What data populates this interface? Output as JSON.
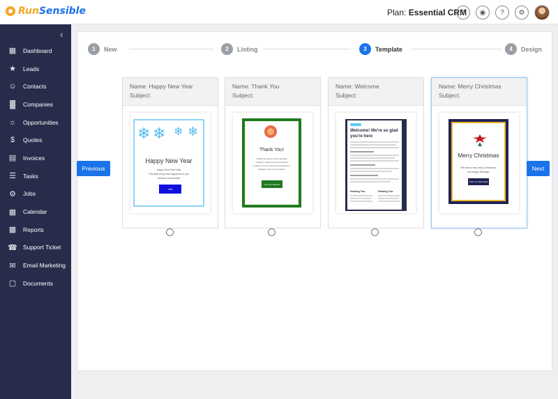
{
  "brand": {
    "part1": "Run",
    "part2": "Sensible"
  },
  "header": {
    "plan_label": "Plan:",
    "plan_name": "Essential CRM",
    "icons": [
      "help-rocket-icon",
      "notification-icon",
      "question-icon",
      "settings-icon"
    ]
  },
  "sidebar": {
    "items": [
      {
        "label": "Dashboard",
        "icon": "dashboard-icon"
      },
      {
        "label": "Leads",
        "icon": "leads-icon"
      },
      {
        "label": "Contacts",
        "icon": "contacts-icon"
      },
      {
        "label": "Companies",
        "icon": "companies-icon"
      },
      {
        "label": "Opportunities",
        "icon": "opportunities-icon"
      },
      {
        "label": "Quotes",
        "icon": "quotes-icon"
      },
      {
        "label": "Invoices",
        "icon": "invoices-icon"
      },
      {
        "label": "Tasks",
        "icon": "tasks-icon"
      },
      {
        "label": "Jobs",
        "icon": "jobs-icon"
      },
      {
        "label": "Calendar",
        "icon": "calendar-icon"
      },
      {
        "label": "Reports",
        "icon": "reports-icon"
      },
      {
        "label": "Support Ticket",
        "icon": "support-icon"
      },
      {
        "label": "Email Marketing",
        "icon": "email-icon"
      },
      {
        "label": "Documents",
        "icon": "documents-icon"
      }
    ]
  },
  "stepper": {
    "steps": [
      {
        "num": "1",
        "label": "New",
        "active": false
      },
      {
        "num": "2",
        "label": "Listing",
        "active": false
      },
      {
        "num": "3",
        "label": "Template",
        "active": true
      },
      {
        "num": "4",
        "label": "Design",
        "active": false
      }
    ]
  },
  "nav_buttons": {
    "previous": "Previous",
    "next": "Next"
  },
  "templates": [
    {
      "name": "Name: Happy New Year",
      "subject": "Subject:",
      "title": "Happy New Year",
      "body": [
        "Happy New Year! May",
        "This year bring new happiness to you",
        "and your loved ones!"
      ],
      "button": "Link",
      "selected": false
    },
    {
      "name": "Name: Thank You",
      "subject": "Subject:",
      "title": "Thank You!",
      "body": [
        "Thanks for being a truly important",
        "customer. Please let our wonderful",
        "contact us if you need any assistance or",
        "problems with your purchase."
      ],
      "button": "Visit Our Website",
      "selected": false
    },
    {
      "name": "Name: Welcome",
      "subject": "Subject:",
      "heading": "Welcome! We're so glad you're here",
      "column1": "Heading Two",
      "column2": "Heading Two",
      "selected": false
    },
    {
      "name": "Name: Merry Christmas",
      "subject": "Subject:",
      "title": "Merry Christmas",
      "body": [
        "We wish a very merry Christmas,",
        "and Happy Holidays."
      ],
      "button": "Click our Web Deals",
      "selected": true
    }
  ]
}
